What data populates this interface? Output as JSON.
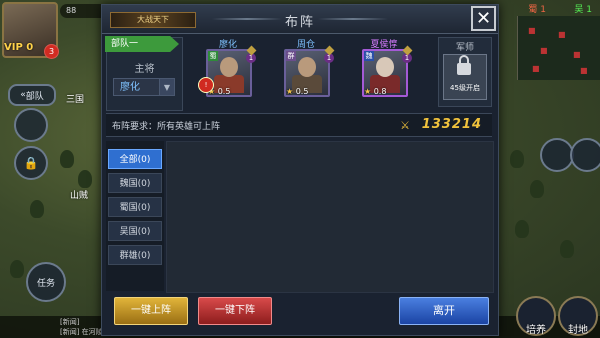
{
  "background": {
    "hud_top_left": {
      "resource": "88",
      "vip": "VIP 0",
      "badge": "3"
    },
    "side_items": [
      {
        "label": "部队",
        "count": "0"
      },
      {
        "label": "三国"
      },
      {
        "label": "山贼"
      },
      {
        "label": "任务"
      }
    ],
    "top_right": {
      "shu_label": "蜀",
      "shu_value": "1",
      "wu_label": "吴",
      "wu_value": "1"
    },
    "bottom_icons": [
      {
        "label": "培养"
      },
      {
        "label": "封地"
      }
    ],
    "chat": [
      "[新闻]",
      "[新闻] 在河陵卖出大量..."
    ]
  },
  "dialog": {
    "title": "布阵",
    "logo_text": "大战天下",
    "close_label": "✕",
    "team": {
      "tab_label": "部队一",
      "zhujiang_label": "主将",
      "selected": "廖化",
      "arrow": "▼"
    },
    "heroes": [
      {
        "name": "廖化",
        "name_color": "#7fc2ff",
        "faction": "蜀",
        "faction_color": "#2f8a3a",
        "level": "1",
        "cost": "0.5",
        "red_badge": "!"
      },
      {
        "name": "周仓",
        "name_color": "#7fc2ff",
        "faction": "群",
        "faction_color": "#6b4d8c",
        "level": "1",
        "cost": "0.5"
      },
      {
        "name": "夏侯惇",
        "name_color": "#d77cff",
        "faction": "魏",
        "faction_color": "#2b4fa8",
        "level": "1",
        "cost": "0.8"
      }
    ],
    "junshi": {
      "title": "军师",
      "unlock_text": "45级开启"
    },
    "requirement": {
      "text": "布阵要求：所有英雄可上阵",
      "power": "133214"
    },
    "filters": [
      {
        "label": "全部(0)",
        "active": true
      },
      {
        "label": "魏国(0)"
      },
      {
        "label": "蜀国(0)"
      },
      {
        "label": "吴国(0)"
      },
      {
        "label": "群雄(0)"
      }
    ],
    "buttons": {
      "all_on": "一键上阵",
      "all_off": "一键下阵",
      "leave": "离开"
    }
  }
}
